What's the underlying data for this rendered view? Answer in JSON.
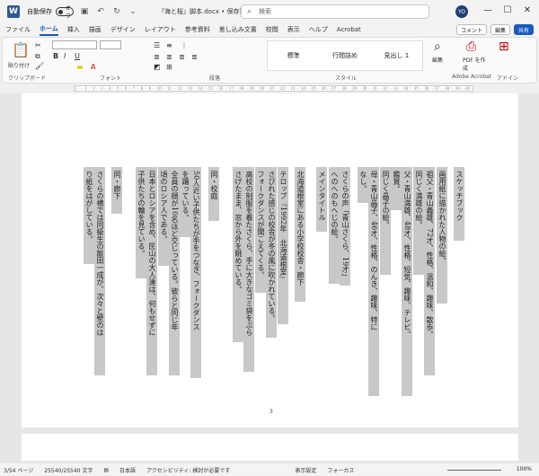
{
  "titlebar": {
    "autosave_label": "自動保存",
    "autosave_state": "オフ",
    "doc_name": "『海と桜』脚本.docx • 保存済み",
    "search_placeholder": "検索",
    "user_initials": "YO"
  },
  "menu": {
    "tabs": [
      "ファイル",
      "ホーム",
      "挿入",
      "描画",
      "デザイン",
      "レイアウト",
      "参考資料",
      "差し込み文書",
      "校閲",
      "表示",
      "ヘルプ",
      "Acrobat"
    ],
    "active": "ホーム",
    "comment": "コメント",
    "edit": "編集",
    "share": "共有"
  },
  "ribbon": {
    "paste": "貼り付け",
    "clipboard": "クリップボード",
    "font": "フォント",
    "paragraph": "段落",
    "style_group": "スタイル",
    "styles": [
      "標準",
      "行間詰め",
      "見出し 1"
    ],
    "edit_label": "編集",
    "pdf_label": "PDF を作成",
    "acrobat": "Adobe Acrobat",
    "addin": "アドイン"
  },
  "document": {
    "columns": [
      "１",
      "スケッチブック",
      "画用紙に描かれた人物の絵。",
      "祖父・青山義雄、72才、性格、温和、趣味、散歩。",
      "同じく満雄の絵。",
      "父・青山満雄、48才、性格、短気、趣味、テレビ。",
      "鑑賞。",
      "同じく晶子の絵。",
      "母・青山晶子、46才、性格、のんき、趣味、特に",
      "なし。",
      "さくらの声「青山さくら、19才」",
      "へのへのもへじの絵。",
      "メインタイトル",
      "２",
      "北海道根室にある小学校校舎・廊下",
      "テロップ『1992年　北海道根室』",
      "さびれた感じの校舎が冬の風に吹かれている。",
      "フォークダンスが聞こえてくる。",
      "高校の制服を着たさくら、手に大きなゴミ袋をぶら",
      "さげたまま、窓から外を眺めている。",
      "３",
      "同・校庭",
      "50人近い子供たちが手をつなぎ、フォークダンス",
      "を踊っている。",
      "全員の顔が10名ほど交じっている。彼らと同じ年",
      "頃のロシア人である。",
      "日本とロシアを含め、民山の大人達は、何もせずに",
      "子供たちの輪を見ている。",
      "４",
      "同・廊下",
      "さくらの横では同級生の飯田一成が、次々と壁のは",
      "り紙をはがしている。"
    ],
    "page_number": "3"
  },
  "status": {
    "page": "3/54 ページ",
    "words": "25540/25540 文字",
    "lang": "日本語",
    "accessibility": "アクセシビリティ: 検討が必要です",
    "display": "表示設定",
    "focus": "フォーカス",
    "zoom": "100%"
  }
}
